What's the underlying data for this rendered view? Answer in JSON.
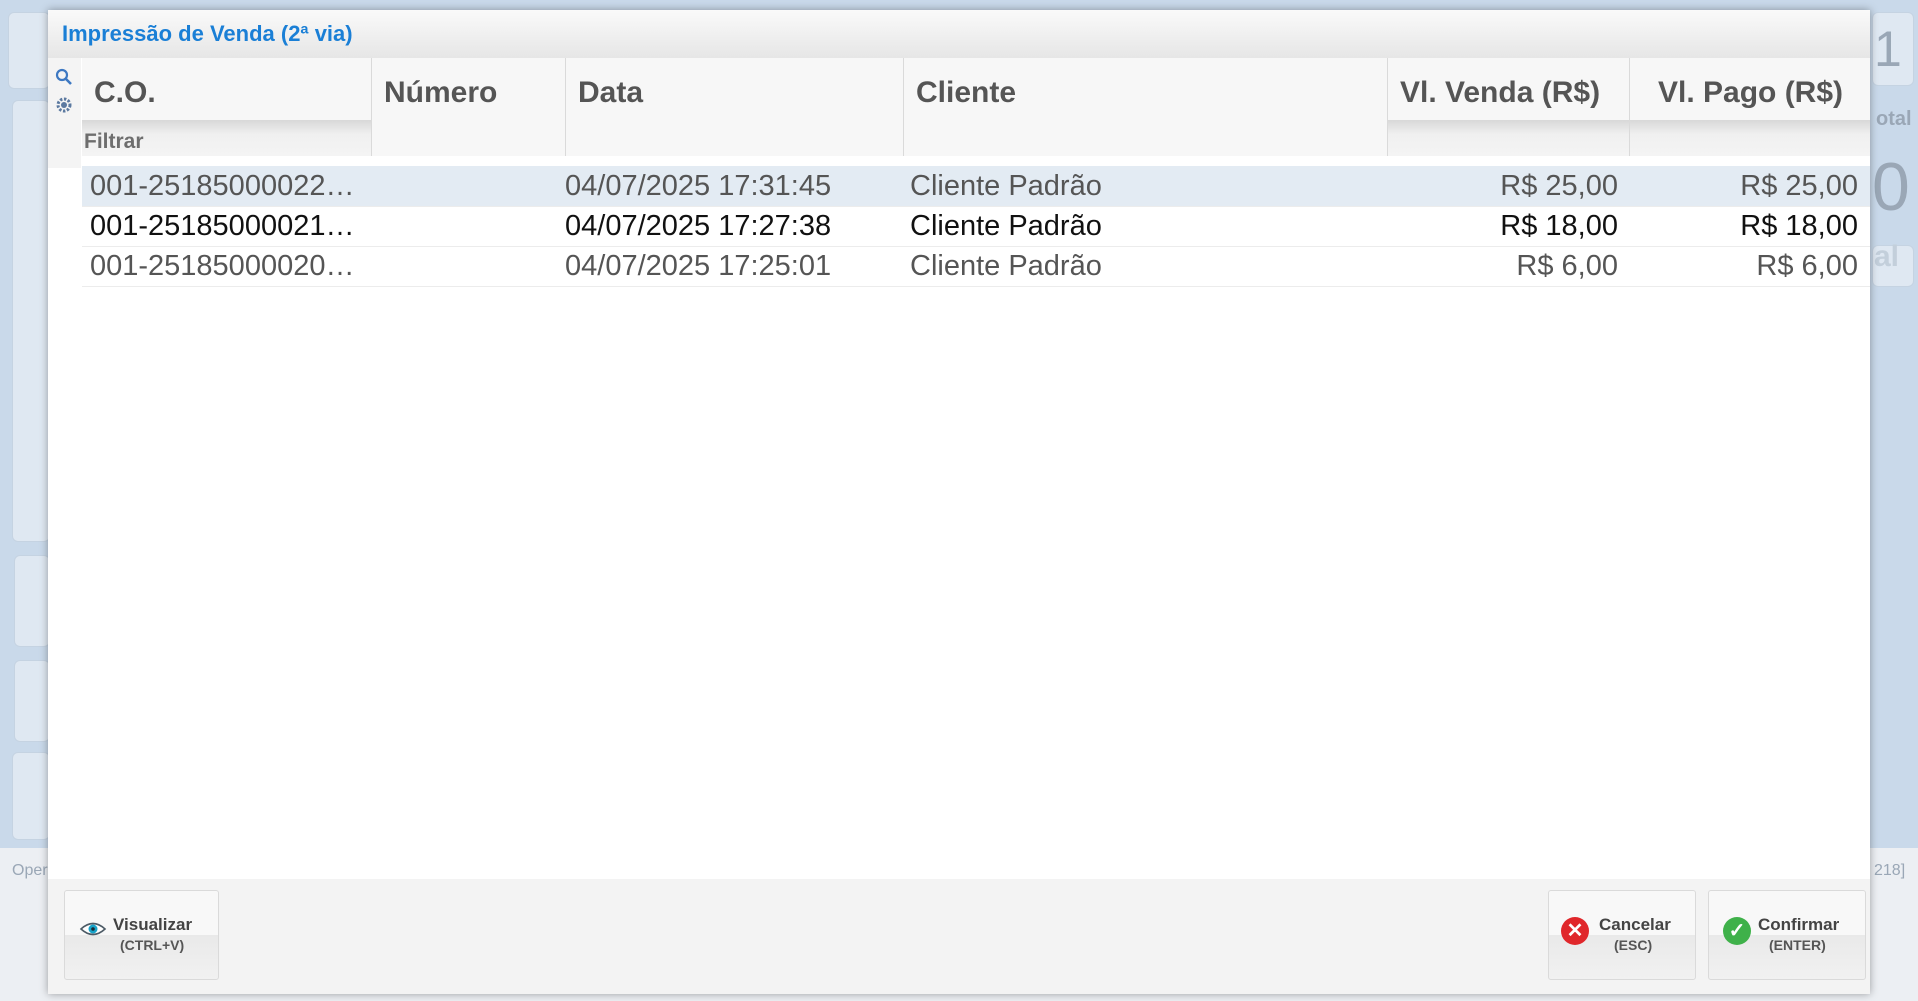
{
  "modal": {
    "title": "Impressão de Venda (2ª via)"
  },
  "columns": {
    "co": "C.O.",
    "numero": "Número",
    "data": "Data",
    "cliente": "Cliente",
    "vl_venda": "Vl. Venda (R$)",
    "vl_pago": "Vl. Pago (R$)",
    "filter_label": "Filtrar"
  },
  "rows": [
    {
      "co": "001-25185000022…",
      "numero": "",
      "data": "04/07/2025 17:31:45",
      "cliente": "Cliente Padrão",
      "vl_venda": "R$ 25,00",
      "vl_pago": "R$ 25,00"
    },
    {
      "co": "001-25185000021…",
      "numero": "",
      "data": "04/07/2025 17:27:38",
      "cliente": "Cliente Padrão",
      "vl_venda": "R$ 18,00",
      "vl_pago": "R$ 18,00"
    },
    {
      "co": "001-25185000020…",
      "numero": "",
      "data": "04/07/2025 17:25:01",
      "cliente": "Cliente Padrão",
      "vl_venda": "R$ 6,00",
      "vl_pago": "R$ 6,00"
    }
  ],
  "buttons": {
    "visualizar": {
      "label": "Visualizar",
      "shortcut": "(CTRL+V)"
    },
    "cancelar": {
      "label": "Cancelar",
      "shortcut": "(ESC)"
    },
    "confirmar": {
      "label": "Confirmar",
      "shortcut": "(ENTER)"
    }
  },
  "background": {
    "left_fragment": "Oper",
    "right_fragment_total": "otal",
    "right_fragment_num": "1",
    "right_fragment_zero": "0",
    "right_fragment_al": "al",
    "right_fragment_code": "218]"
  },
  "colors": {
    "title": "#1a7fd6",
    "selected_row": "#e3ebf3",
    "cancel": "#e0272b",
    "confirm": "#3fb14a"
  }
}
